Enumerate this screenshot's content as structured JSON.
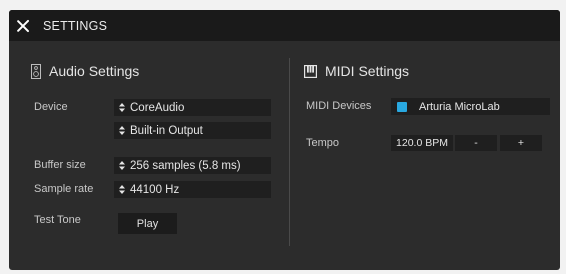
{
  "window": {
    "title": "SETTINGS"
  },
  "audio": {
    "header": "Audio Settings",
    "device_label": "Device",
    "device_value": "CoreAudio",
    "output_value": "Built-in Output",
    "buffer_label": "Buffer size",
    "buffer_value": "256 samples (5.8 ms)",
    "rate_label": "Sample rate",
    "rate_value": "44100 Hz",
    "tone_label": "Test Tone",
    "play_label": "Play"
  },
  "midi": {
    "header": "MIDI Settings",
    "devices_label": "MIDI Devices",
    "device_name": "Arturia MicroLab",
    "device_checked": true,
    "checkbox_color": "#29a8e0",
    "tempo_label": "Tempo",
    "tempo_value": "120.0 BPM",
    "minus_label": "-",
    "plus_label": "+"
  },
  "icons": {
    "close": "close-icon",
    "audio": "speaker-icon",
    "midi": "piano-keys-icon",
    "select": "up-down-arrows-icon"
  }
}
